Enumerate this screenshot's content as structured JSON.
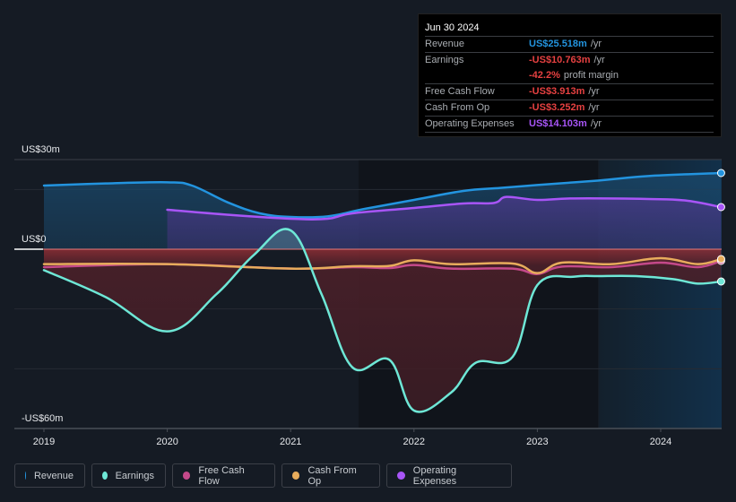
{
  "tooltip": {
    "date": "Jun 30 2024",
    "rows": [
      {
        "label": "Revenue",
        "value": "US$25.518m",
        "unit": "/yr",
        "color": "#2394df"
      },
      {
        "label": "Earnings",
        "value": "-US$10.763m",
        "unit": "/yr",
        "color": "#e64141"
      },
      {
        "label": "",
        "value": "-42.2%",
        "unit": "profit margin",
        "color": "#e64141"
      },
      {
        "label": "Free Cash Flow",
        "value": "-US$3.913m",
        "unit": "/yr",
        "color": "#e64141"
      },
      {
        "label": "Cash From Op",
        "value": "-US$3.252m",
        "unit": "/yr",
        "color": "#e64141"
      },
      {
        "label": "Operating Expenses",
        "value": "US$14.103m",
        "unit": "/yr",
        "color": "#a855f7"
      }
    ]
  },
  "legend": [
    {
      "label": "Revenue",
      "color": "#2394df"
    },
    {
      "label": "Earnings",
      "color": "#6ee7d6"
    },
    {
      "label": "Free Cash Flow",
      "color": "#c4498a"
    },
    {
      "label": "Cash From Op",
      "color": "#e8ac5c"
    },
    {
      "label": "Operating Expenses",
      "color": "#a855f7"
    }
  ],
  "chart_data": {
    "type": "line",
    "title": "",
    "xlabel": "",
    "ylabel": "",
    "ylim": [
      -60,
      30
    ],
    "xlim": [
      2019.0,
      2024.49
    ],
    "y_tick_labels": [
      {
        "value": 30,
        "label": "US$30m"
      },
      {
        "value": 0,
        "label": "US$0"
      },
      {
        "value": -60,
        "label": "-US$60m"
      }
    ],
    "x_ticks": [
      2019,
      2020,
      2021,
      2022,
      2023,
      2024
    ],
    "x_tick_labels": [
      "2019",
      "2020",
      "2021",
      "2022",
      "2023",
      "2024"
    ],
    "gridlines_y": [
      30,
      20,
      0,
      -20,
      -40,
      -60
    ],
    "highlight_range": [
      2023.5,
      2024.49
    ],
    "legend_position": "bottom",
    "series": [
      {
        "name": "Revenue",
        "color": "#2394df",
        "fill": true,
        "x": [
          2019.0,
          2019.5,
          2020.0,
          2020.2,
          2020.5,
          2020.75,
          2021.0,
          2021.3,
          2021.6,
          2022.0,
          2022.4,
          2022.7,
          2023.0,
          2023.5,
          2023.9,
          2024.49
        ],
        "values": [
          21.3,
          22.0,
          22.4,
          21.3,
          15.5,
          12.0,
          10.8,
          11.0,
          13.5,
          16.5,
          19.5,
          20.5,
          21.5,
          23.0,
          24.5,
          25.5
        ]
      },
      {
        "name": "Operating Expenses",
        "color": "#a855f7",
        "fill": true,
        "x": [
          2020.0,
          2020.5,
          2021.0,
          2021.3,
          2021.5,
          2022.0,
          2022.4,
          2022.65,
          2022.75,
          2023.0,
          2023.3,
          2023.9,
          2024.2,
          2024.49
        ],
        "values": [
          13.2,
          11.5,
          10.2,
          10.2,
          12.0,
          13.8,
          15.3,
          15.5,
          17.5,
          16.5,
          17.0,
          16.8,
          16.3,
          14.1
        ]
      },
      {
        "name": "Earnings",
        "color": "#6ee7d6",
        "fill": true,
        "x": [
          2019.0,
          2019.5,
          2020.0,
          2020.4,
          2020.7,
          2021.0,
          2021.25,
          2021.5,
          2021.8,
          2022.0,
          2022.3,
          2022.5,
          2022.8,
          2023.0,
          2023.3,
          2023.5,
          2023.8,
          2024.1,
          2024.3,
          2024.49
        ],
        "values": [
          -7.0,
          -16.0,
          -27.5,
          -15.0,
          -2.0,
          6.3,
          -15.0,
          -39.5,
          -37.0,
          -54.0,
          -48.0,
          -38.0,
          -36.0,
          -12.0,
          -9.2,
          -9.0,
          -9.0,
          -10.0,
          -11.5,
          -10.8
        ]
      },
      {
        "name": "Free Cash Flow",
        "color": "#c4498a",
        "fill": false,
        "x": [
          2019.0,
          2020.0,
          2021.0,
          2021.5,
          2021.8,
          2022.0,
          2022.3,
          2022.8,
          2023.0,
          2023.2,
          2023.6,
          2024.0,
          2024.3,
          2024.49
        ],
        "values": [
          -6.0,
          -5.0,
          -6.5,
          -6.0,
          -6.3,
          -5.3,
          -6.5,
          -6.5,
          -8.3,
          -5.8,
          -6.0,
          -4.5,
          -6.0,
          -3.9
        ]
      },
      {
        "name": "Cash From Op",
        "color": "#e8ac5c",
        "fill": false,
        "x": [
          2019.0,
          2020.0,
          2021.0,
          2021.5,
          2021.8,
          2022.0,
          2022.3,
          2022.8,
          2023.0,
          2023.2,
          2023.6,
          2024.0,
          2024.3,
          2024.49
        ],
        "values": [
          -5.0,
          -5.0,
          -6.5,
          -5.7,
          -5.6,
          -3.7,
          -5.0,
          -4.8,
          -8.0,
          -4.5,
          -5.0,
          -3.0,
          -5.0,
          -3.3
        ]
      }
    ]
  }
}
